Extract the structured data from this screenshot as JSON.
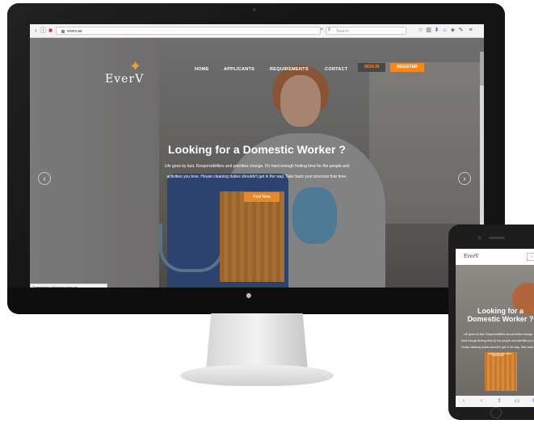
{
  "browser": {
    "url": "everv.ae",
    "search_placeholder": "Search",
    "status_text": "Transferring data from everv.ae..."
  },
  "site": {
    "logo_text": "EverV",
    "nav": [
      "HOME",
      "APPLICANTS",
      "REQUIREMENTS",
      "CONTACT"
    ],
    "sign_in_label": "SIGN IN",
    "register_label": "REGISTER",
    "hero_title": "Looking for a Domestic Worker ?",
    "hero_text_line1": "Life goes by fast. Responsibilities and priorities change. It's hard enough finding time for the people and",
    "hero_text_line2": "activities you love. House cleaning duties shouldn't get in the way. Take back your precious free time.",
    "cta_label": "Find Now"
  },
  "phone": {
    "logo_text": "EverV",
    "menu_label": "≡",
    "hero_title_line1": "Looking for a",
    "hero_title_line2": "Domestic Worker ?",
    "hero_text": "Life goes by fast. Responsibilities and priorities change. It's hard enough finding time for the people and activities you love. House cleaning duties shouldn't get in the way. Take back your precious free time.",
    "cta_label": "Find Now"
  },
  "colors": {
    "accent": "#f2891c",
    "signin_bg": "#474747",
    "bezel": "#141414"
  }
}
